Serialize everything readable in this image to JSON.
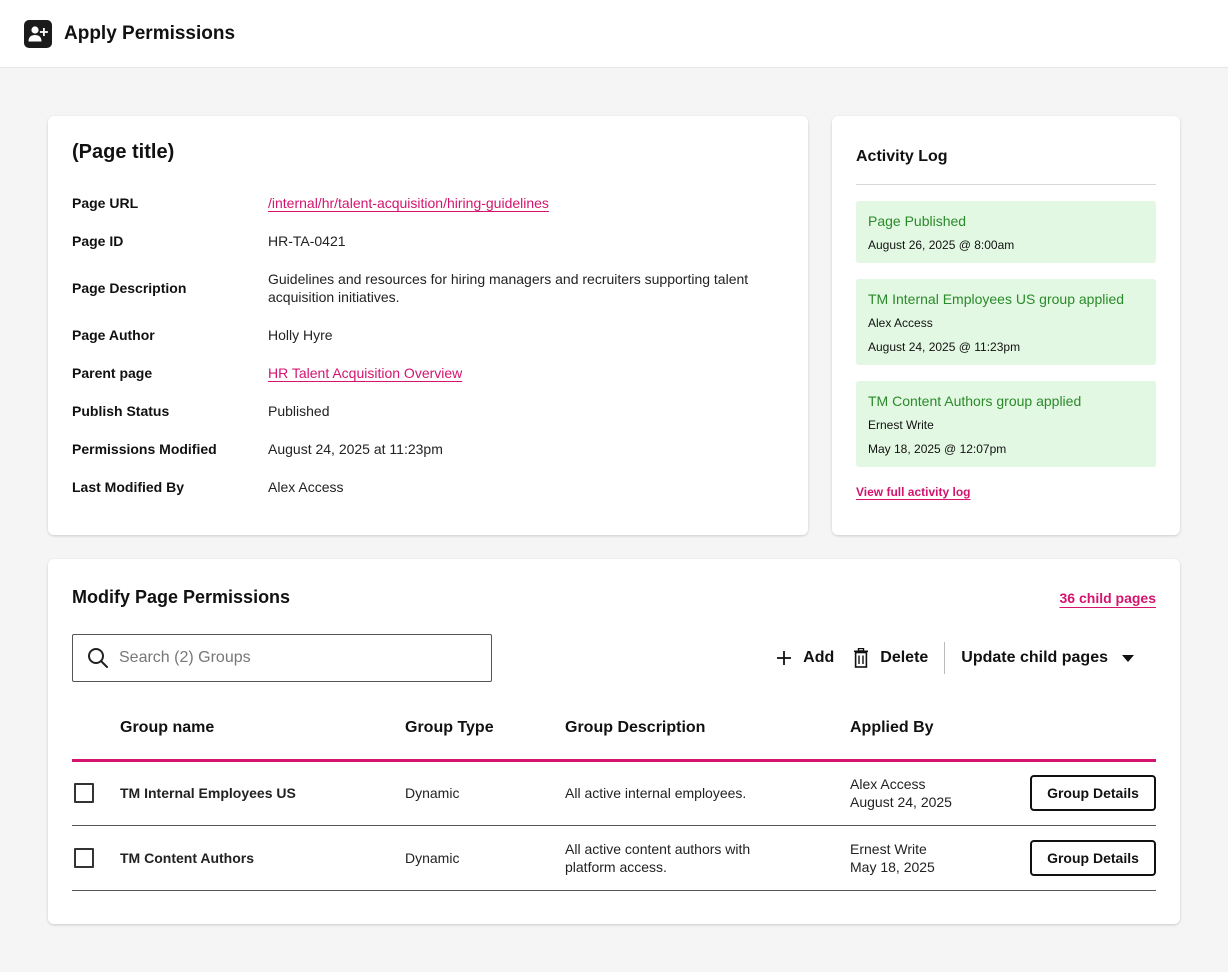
{
  "app": {
    "title": "Apply Permissions",
    "icon": "person-add-icon"
  },
  "page_info": {
    "title": "(Page title)",
    "rows": [
      {
        "label": "Page URL",
        "value": "/internal/hr/talent-acquisition/hiring-guidelines"
      },
      {
        "label": "Page ID",
        "value": "HR-TA-0421"
      },
      {
        "label": "Page Description",
        "value": "Guidelines and resources for hiring managers and recruiters supporting talent acquisition initiatives."
      },
      {
        "label": "Page Author",
        "value": "Holly Hyre"
      },
      {
        "label": "Parent page",
        "value": "HR Talent Acquisition Overview"
      },
      {
        "label": "Publish Status",
        "value": "Published"
      },
      {
        "label": "Permissions Modified",
        "value": "August 24, 2025 at 11:23pm"
      },
      {
        "label": "Last Modified By",
        "value": "Alex Access"
      }
    ]
  },
  "activity_log": {
    "title": "Activity Log",
    "items": [
      {
        "event": "Page Published",
        "user": "",
        "timestamp": "August 26, 2025 @ 8:00am"
      },
      {
        "event": "TM Internal Employees US group applied",
        "user": "Alex Access",
        "timestamp": "August 24, 2025 @ 11:23pm"
      },
      {
        "event": "TM Content Authors group applied",
        "user": "Ernest Write",
        "timestamp": "May 18, 2025 @ 12:07pm"
      }
    ],
    "view_full_label": "View full activity log"
  },
  "permissions": {
    "title": "Modify Page Permissions",
    "child_pages_label": "36 child pages",
    "search_placeholder": "Search (2) Groups",
    "add_label": "Add",
    "delete_label": "Delete",
    "update_child_label": "Update child pages",
    "columns": [
      "Group name",
      "Group Type",
      "Group Description",
      "Applied By"
    ],
    "rows": [
      {
        "name": "TM Internal Employees US",
        "type": "Dynamic",
        "description": "All active internal employees.",
        "applied_by": "Alex Access",
        "applied_date": "August 24, 2025",
        "button": "Group Details"
      },
      {
        "name": "TM Content Authors",
        "type": "Dynamic",
        "description": "All active content authors with platform access.",
        "applied_by": "Ernest Write",
        "applied_date": "May 18, 2025",
        "button": "Group Details"
      }
    ]
  },
  "colors": {
    "accent": "#d4146f",
    "success_bg": "#e3f8e3",
    "success_text": "#2a8a2a"
  }
}
